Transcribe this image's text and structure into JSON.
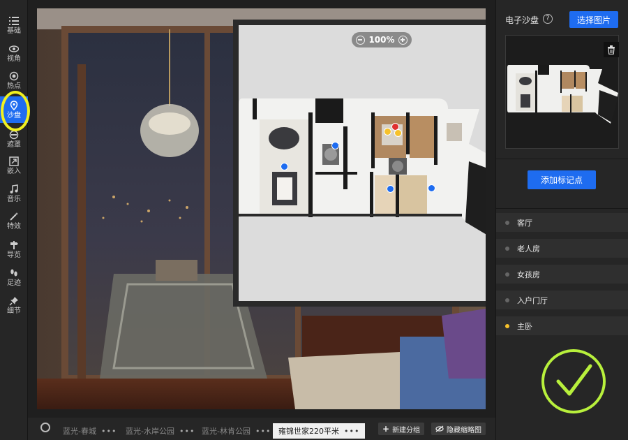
{
  "toolbar": {
    "items": [
      {
        "label": "基础",
        "icon": "list-icon"
      },
      {
        "label": "视角",
        "icon": "eye-icon"
      },
      {
        "label": "热点",
        "icon": "hotspot-icon"
      },
      {
        "label": "沙盘",
        "icon": "location-pin-icon",
        "active": true
      },
      {
        "label": "遮罩",
        "icon": "mask-icon"
      },
      {
        "label": "嵌入",
        "icon": "embed-icon"
      },
      {
        "label": "音乐",
        "icon": "music-icon"
      },
      {
        "label": "特效",
        "icon": "magic-wand-icon"
      },
      {
        "label": "导览",
        "icon": "signpost-icon"
      },
      {
        "label": "足迹",
        "icon": "footprint-icon"
      },
      {
        "label": "细节",
        "icon": "pin-icon"
      }
    ]
  },
  "floorplan": {
    "zoom_label": "100%"
  },
  "scene_tabs": {
    "items": [
      {
        "label": "蓝光-春城",
        "dots": "•••"
      },
      {
        "label": "蓝光-水岸公园",
        "dots": "•••"
      },
      {
        "label": "蓝光-林肯公园",
        "dots": "•••"
      },
      {
        "label": "雍锦世家220平米",
        "dots": "•••",
        "active": true
      }
    ],
    "new_group": "新建分组",
    "hide_thumbs": "隐藏缩略图"
  },
  "sandbox_panel": {
    "title": "电子沙盘",
    "help": "?",
    "select_image": "选择图片",
    "add_marker": "添加标记点",
    "rooms": [
      {
        "name": "客厅",
        "current": false
      },
      {
        "name": "老人房",
        "current": false
      },
      {
        "name": "女孩房",
        "current": false
      },
      {
        "name": "入户门厅",
        "current": false
      },
      {
        "name": "主卧",
        "current": true
      }
    ]
  },
  "colors": {
    "accent": "#1e6cf0",
    "highlight_ring": "#f0f020",
    "check_mark": "#b8f03c",
    "marker_blue": "#1e6cf0",
    "marker_red": "#e03030",
    "marker_yellow": "#f6c12b",
    "current_dot": "#f6c12b"
  }
}
